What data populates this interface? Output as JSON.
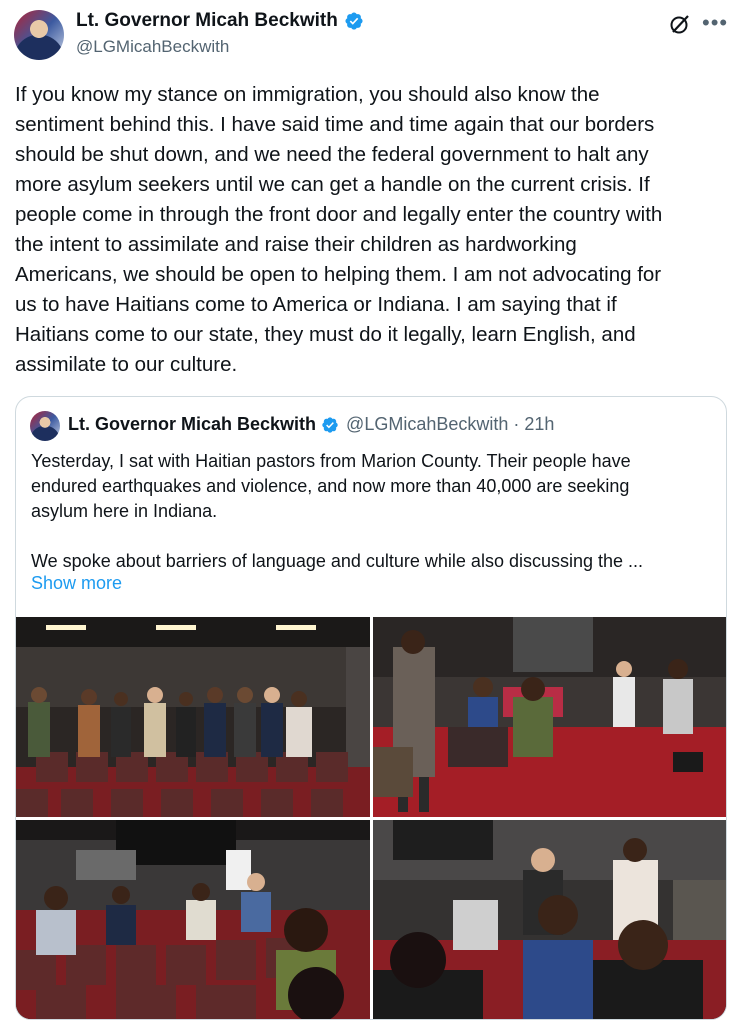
{
  "author": {
    "name": "Lt. Governor Micah Beckwith",
    "handle": "@LGMicahBeckwith",
    "avatar_icon": "profile-avatar",
    "verified_icon": "verified-badge-icon",
    "verified_color": "#1d9bf0"
  },
  "header_icons": {
    "grok": "grok-icon",
    "more": "more-options-icon",
    "more_glyph": "•••"
  },
  "tweet": {
    "text": "If you know my stance on immigration, you should also know the\nsentiment behind this. I have said time and time again that our borders\nshould be shut down, and we need the federal government to halt any\nmore asylum seekers until we can get a handle on the current crisis. If\npeople come in through the front door and legally enter the country with\nthe intent to assimilate and raise their children as hardworking\nAmericans, we should be open to helping them. I am not advocating for\nus to have Haitians come to America or Indiana. I am saying that if\nHaitians come to our state, they must do it legally, learn English, and\nassimilate to our culture."
  },
  "quoted": {
    "name": "Lt. Governor Micah Beckwith",
    "handle": "@LGMicahBeckwith",
    "dot": "·",
    "time": "21h",
    "text": "Yesterday, I sat with Haitian pastors from Marion County. Their people have\nendured earthquakes and violence, and now more than 40,000 are seeking\nasylum here in Indiana.\n\nWe spoke about barriers of language and culture while also discussing the ...",
    "show_more": "Show more",
    "link_color": "#1d9bf0",
    "photos": [
      "group-photo",
      "meeting-photo-1",
      "meeting-photo-2",
      "meeting-photo-3"
    ]
  }
}
